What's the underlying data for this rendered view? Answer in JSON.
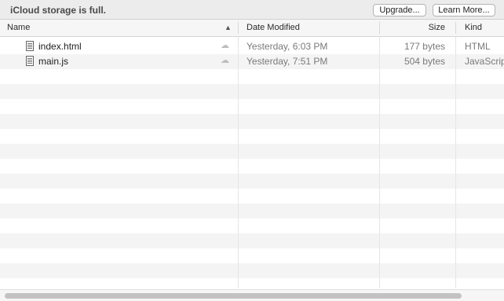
{
  "banner": {
    "message": "iCloud storage is full.",
    "upgrade_label": "Upgrade...",
    "learn_more_label": "Learn More..."
  },
  "columns": {
    "name": "Name",
    "date": "Date Modified",
    "size": "Size",
    "kind": "Kind",
    "sort_icon": "chevron-up-icon"
  },
  "files": [
    {
      "name": "index.html",
      "date": "Yesterday, 6:03 PM",
      "size": "177 bytes",
      "kind": "HTML",
      "icon": "document-icon",
      "status_icon": "cloud-upload-icon"
    },
    {
      "name": "main.js",
      "date": "Yesterday, 7:51 PM",
      "size": "504 bytes",
      "kind": "JavaScript",
      "icon": "document-icon",
      "status_icon": "cloud-upload-icon"
    }
  ]
}
